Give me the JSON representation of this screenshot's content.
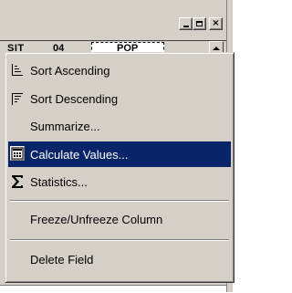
{
  "window": {
    "controls": {
      "minimize": "_",
      "maximize": "□",
      "close": "×"
    },
    "column_headers": [
      "SIT",
      "04",
      "POP"
    ]
  },
  "menu": {
    "items": [
      {
        "label": "Sort Ascending",
        "icon": "sort-ascending-icon"
      },
      {
        "label": "Sort Descending",
        "icon": "sort-descending-icon"
      },
      {
        "label": "Summarize...",
        "icon": ""
      },
      {
        "label": "Calculate Values...",
        "icon": "calculator-icon",
        "highlighted": true
      },
      {
        "label": "Statistics...",
        "icon": "sigma-icon"
      },
      {
        "label": "Freeze/Unfreeze Column",
        "icon": ""
      },
      {
        "label": "Delete Field",
        "icon": ""
      }
    ]
  },
  "colors": {
    "highlight": "#0a246a",
    "menu_face": "#d4d0c8",
    "highlight_text": "#ffffff"
  }
}
